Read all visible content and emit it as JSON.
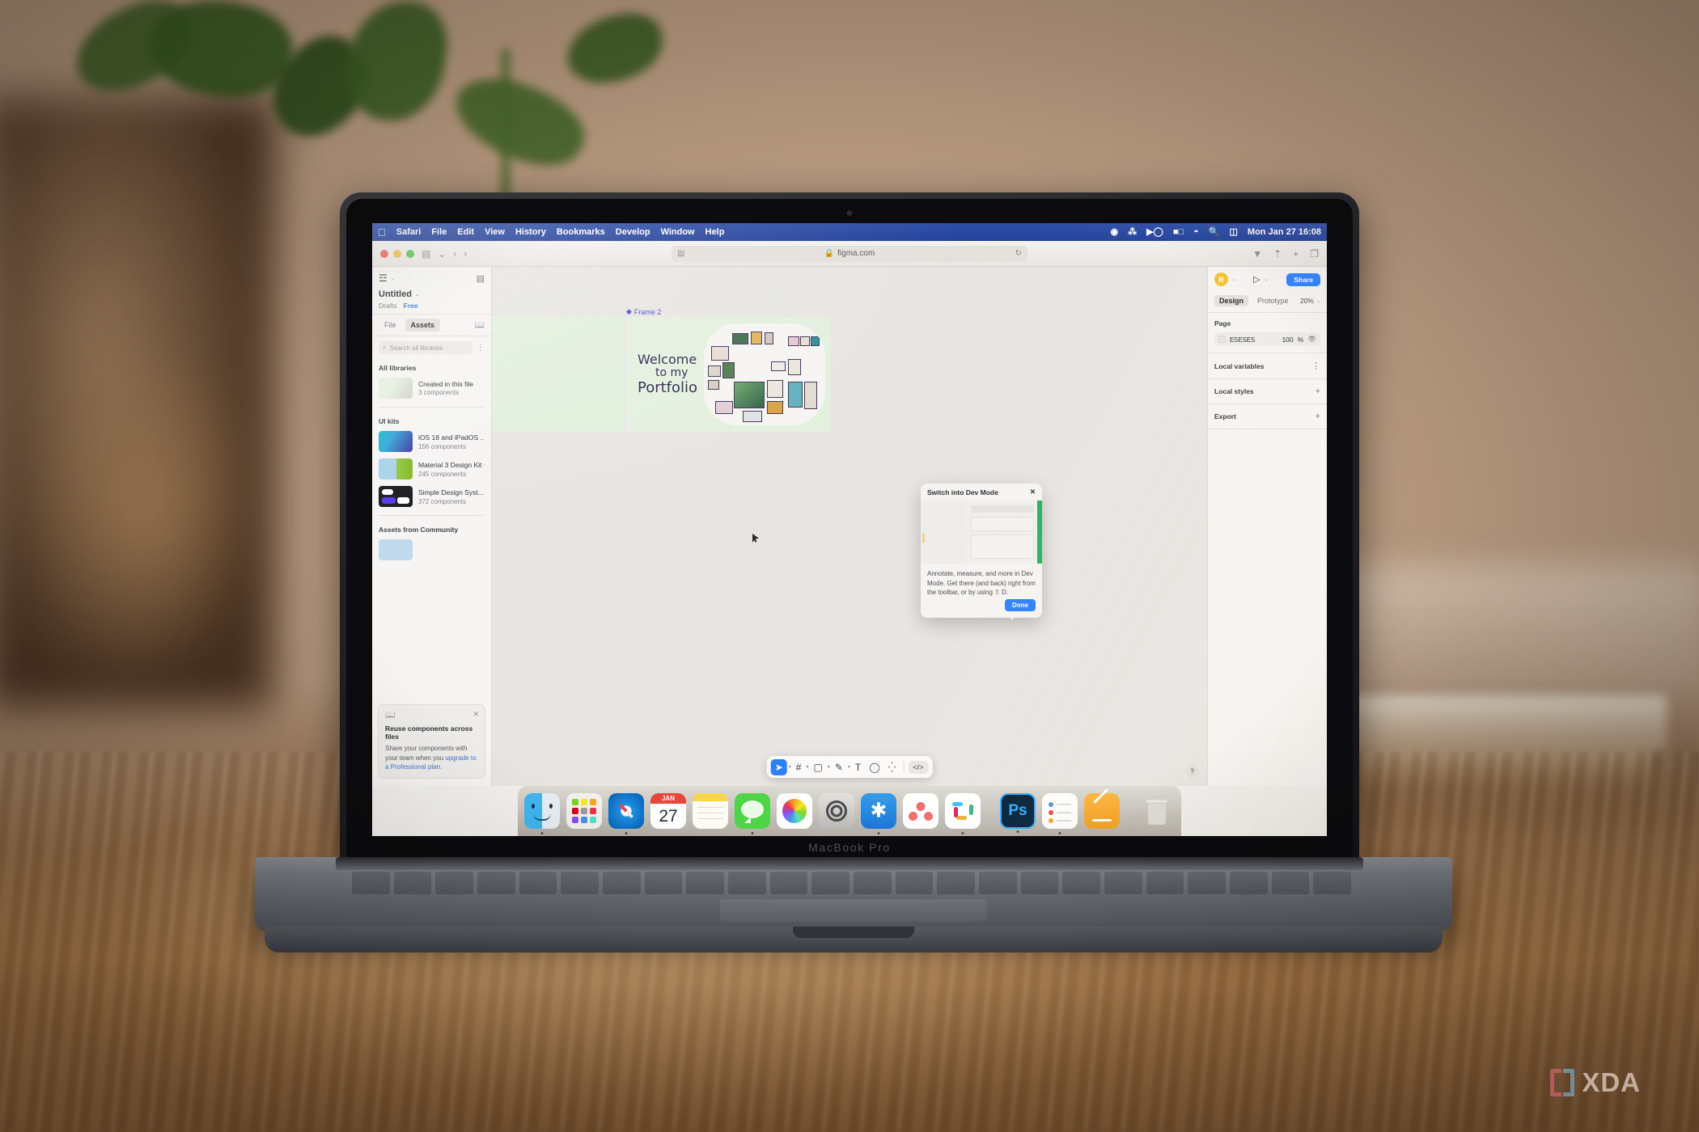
{
  "menubar": {
    "apple_icon": "apple-icon",
    "items": [
      "Safari",
      "File",
      "Edit",
      "View",
      "History",
      "Bookmarks",
      "Develop",
      "Window",
      "Help"
    ],
    "status_icons": [
      "creative-cloud-icon",
      "dropbox-icon",
      "now-playing-icon",
      "battery-icon",
      "wifi-icon",
      "search-icon",
      "control-center-icon"
    ],
    "clock": "Mon Jan 27  16:08"
  },
  "safari": {
    "traffic_lights": [
      "close-button",
      "minimize-button",
      "zoom-button"
    ],
    "sidebar_icon": "sidebar-icon",
    "sidebar_caret": "⌄",
    "back": "‹",
    "forward": "›",
    "url_reader_icon": "reader-icon",
    "lock_icon": "🔒",
    "url": "figma.com",
    "reload_icon": "↻",
    "right_icons": [
      "downloads-icon",
      "share-icon",
      "new-tab-icon",
      "tab-overview-icon"
    ]
  },
  "figma": {
    "left": {
      "logo": "figma-logo-icon",
      "logo_caret": "⌄",
      "panel_toggle_icon": "panel-toggle-icon",
      "file_name": "Untitled",
      "file_caret": "⌄",
      "breadcrumb_drafts": "Drafts",
      "breadcrumb_plan": "Free",
      "tabs": [
        {
          "label": "File",
          "active": false
        },
        {
          "label": "Assets",
          "active": true
        }
      ],
      "book_icon": "book-icon",
      "search_placeholder": "Search all libraries",
      "search_icon": "search-icon",
      "filter_icon": "filter-icon",
      "sections": [
        {
          "title": "All libraries",
          "items": [
            {
              "name": "Created in this file",
              "count": "3 components",
              "globe": false
            }
          ]
        },
        {
          "title": "UI kits",
          "items": [
            {
              "name": "iOS 18 and iPadOS ...",
              "count": "156 components",
              "globe": true
            },
            {
              "name": "Material 3 Design Kit",
              "count": "245 components",
              "globe": true
            },
            {
              "name": "Simple Design Syst...",
              "count": "372 components",
              "globe": true
            }
          ]
        },
        {
          "title": "Assets from Community",
          "items": []
        }
      ],
      "promo": {
        "icon": "book-icon",
        "close": "✕",
        "title": "Reuse components across files",
        "body_before": "Share your components with your team when you ",
        "link": "upgrade to a Professional plan",
        "body_after": "."
      }
    },
    "canvas": {
      "frame_label": "Frame 2",
      "frame_icon": "frame-diamond-icon",
      "design": {
        "line1": "Welcome",
        "line2": "to my",
        "line3": "Portfolio",
        "background_color": "#e4f1df",
        "text_color": "#2d2452"
      },
      "cursor": "pointer-cursor"
    },
    "dev_popup": {
      "title": "Switch into Dev Mode",
      "close": "✕",
      "body": "Annotate, measure, and more in Dev Mode. Get there (and back) right from the toolbar, or by using ⇧ D.",
      "done_label": "Done"
    },
    "toolbar": {
      "tools": [
        {
          "name": "move-tool",
          "glyph": "➤",
          "active": true,
          "caret": true
        },
        {
          "name": "frame-tool",
          "glyph": "#",
          "active": false,
          "caret": true
        },
        {
          "name": "shape-tool",
          "glyph": "▢",
          "active": false,
          "caret": true
        },
        {
          "name": "pen-tool",
          "glyph": "✎",
          "active": false,
          "caret": true
        },
        {
          "name": "text-tool",
          "glyph": "T",
          "active": false,
          "caret": false
        },
        {
          "name": "comment-tool",
          "glyph": "◯",
          "active": false,
          "caret": false
        },
        {
          "name": "actions-tool",
          "glyph": "⁛",
          "active": false,
          "caret": false
        }
      ],
      "dev_mode_glyph": "</>",
      "help_label": "?"
    },
    "right": {
      "avatar_initial": "R",
      "avatar_color": "#f2c230",
      "avatar_caret": "⌄",
      "present_icon": "play-icon",
      "present_caret": "⌄",
      "share_label": "Share",
      "tabs": [
        {
          "label": "Design",
          "active": true
        },
        {
          "label": "Prototype",
          "active": false
        }
      ],
      "zoom": "20%",
      "zoom_caret": "⌄",
      "page_title": "Page",
      "page_fill_hex": "E5E5E5",
      "page_fill_opacity": "100",
      "page_fill_unit": "%",
      "visibility_icon": "eye-icon",
      "rows": [
        {
          "label": "Local variables",
          "action": "filter-icon"
        },
        {
          "label": "Local styles",
          "action": "+"
        },
        {
          "label": "Export",
          "action": "+"
        }
      ]
    }
  },
  "dock": {
    "items": [
      {
        "name": "finder",
        "label": "Finder"
      },
      {
        "name": "launchpad",
        "label": "Launchpad"
      },
      {
        "name": "safari",
        "label": "Safari"
      },
      {
        "name": "calendar",
        "label": "Calendar",
        "month": "JAN",
        "day": "27"
      },
      {
        "name": "notes",
        "label": "Notes"
      },
      {
        "name": "messages",
        "label": "Messages"
      },
      {
        "name": "photos",
        "label": "Photos"
      },
      {
        "name": "system-settings",
        "label": "System Settings"
      },
      {
        "name": "app-store",
        "label": "App Store"
      },
      {
        "name": "asana",
        "label": "Asana"
      },
      {
        "name": "slack",
        "label": "Slack"
      },
      {
        "name": "photoshop",
        "label": "Ps"
      },
      {
        "name": "reminders",
        "label": "Reminders"
      },
      {
        "name": "pages",
        "label": "Pages"
      },
      {
        "name": "trash",
        "label": "Trash"
      }
    ]
  },
  "laptop": {
    "model_label": "MacBook Pro"
  },
  "watermark": {
    "text": "XDA"
  }
}
